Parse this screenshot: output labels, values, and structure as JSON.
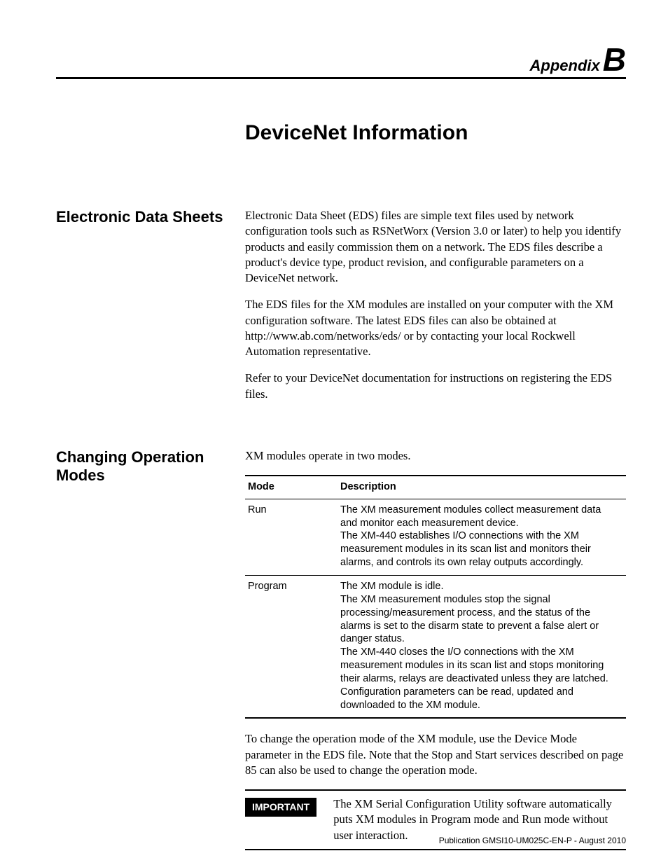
{
  "header": {
    "appendix_word": "Appendix",
    "appendix_letter": "B"
  },
  "chapter_title": "DeviceNet Information",
  "sections": {
    "eds": {
      "heading": "Electronic Data Sheets",
      "p1": "Electronic Data Sheet (EDS) files are simple text files used by network configuration tools such as RSNetWorx (Version 3.0 or later) to help you identify products and easily commission them on a network. The EDS files describe a product's device type, product revision, and configurable parameters on a DeviceNet network.",
      "p2": "The EDS files for the XM modules are installed on your computer with the XM configuration software. The latest EDS files can also be obtained at http://www.ab.com/networks/eds/ or by contacting your local Rockwell Automation representative.",
      "p3": "Refer to your DeviceNet documentation for instructions on registering the EDS files."
    },
    "modes": {
      "heading": "Changing Operation Modes",
      "intro": "XM modules operate in two modes.",
      "table": {
        "headers": {
          "c1": "Mode",
          "c2": "Description"
        },
        "rows": [
          {
            "mode": "Run",
            "desc": "The XM measurement modules collect measurement data and monitor each measurement device.\nThe XM-440 establishes I/O connections with the XM measurement modules in its scan list and monitors their alarms, and controls its own relay outputs accordingly."
          },
          {
            "mode": "Program",
            "desc": "The XM module is idle.\nThe XM measurement modules stop the signal processing/measurement process, and the status of the alarms is set to the disarm state to prevent a false alert or danger status.\nThe XM-440 closes the I/O connections with the XM measurement modules in its scan list and stops monitoring their alarms, relays are deactivated unless they are latched.\nConfiguration parameters can be read, updated and downloaded to the XM module."
          }
        ]
      },
      "after_table": "To change the operation mode of the XM module, use the Device Mode parameter in the EDS file. Note that the Stop and Start services described on page 85 can also be used to change the operation mode.",
      "important_label": "IMPORTANT",
      "important_text": "The XM Serial Configuration Utility software automatically puts XM modules in Program mode and Run mode without user interaction."
    }
  },
  "footer": "Publication GMSI10-UM025C-EN-P - August 2010"
}
